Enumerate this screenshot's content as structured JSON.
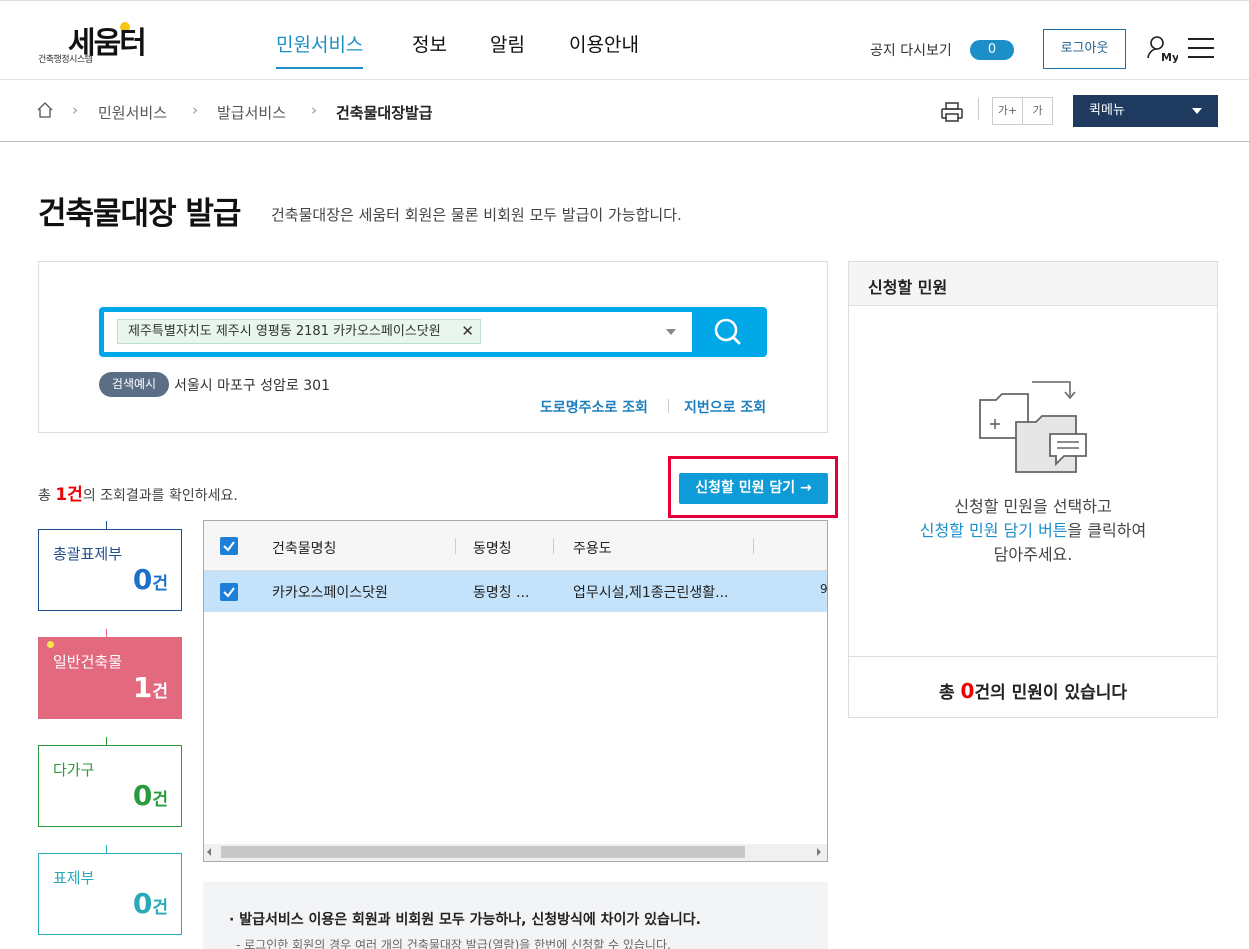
{
  "header": {
    "logo_main": "세움터",
    "logo_sub": "건축행정시스템",
    "nav": [
      "민원서비스",
      "정보",
      "알림",
      "이용안내"
    ],
    "notice_label": "공지 다시보기",
    "notice_count": "0",
    "logout_label": "로그아웃"
  },
  "breadcrumb": {
    "items": [
      "민원서비스",
      "발급서비스",
      "건축물대장발급"
    ],
    "font_up": "가+",
    "font_down": "가",
    "quickmenu": "퀵메뉴"
  },
  "page": {
    "title": "건축물대장 발급",
    "description": "건축물대장은 세움터 회원은 물론 비회원 모두 발급이 가능합니다."
  },
  "search": {
    "chip": "제주특별자치도 제주시 영평동 2181 카카오스페이스닷원",
    "example_badge": "검색예시",
    "example_text": "서울시 마포구 성암로 301",
    "road_link": "도로명주소로 조회",
    "lot_link": "지번으로 조회"
  },
  "result": {
    "prefix": "총 ",
    "count": "1건",
    "suffix": "의 조회결과를 확인하세요.",
    "add_button": "신청할 민원 담기 →"
  },
  "categories": [
    {
      "label": "총괄표제부",
      "count": "0",
      "unit": "건"
    },
    {
      "label": "일반건축물",
      "count": "1",
      "unit": "건"
    },
    {
      "label": "다가구",
      "count": "0",
      "unit": "건"
    },
    {
      "label": "표제부",
      "count": "0",
      "unit": "건"
    }
  ],
  "table": {
    "columns": [
      "건축물명칭",
      "동명칭",
      "주용도"
    ],
    "rows": [
      {
        "name": "카카오스페이스닷원",
        "dong": "동명칭 ...",
        "use": "업무시설,제1종근린생활...",
        "extra": "9"
      }
    ]
  },
  "notice": {
    "line1": "· 발급서비스 이용은 회원과 비회원 모두 가능하나, 신청방식에 차이가 있습니다.",
    "line2": "- 로그인한 회원의 경우 여러 개의 건축물대장 발급(열람)을 한번에 신청할 수 있습니다."
  },
  "cart": {
    "title": "신청할 민원",
    "guide1": "신청할 민원을 선택하고",
    "guide2_blue": "신청할 민원 담기 버튼",
    "guide2_rest": "을 클릭하여",
    "guide3": "담아주세요.",
    "total_prefix": "총 ",
    "total_count": "0",
    "total_suffix": "건의 민원이 있습니다"
  },
  "colors": {
    "accent": "#1d8fc8",
    "highlight": "#e6003a",
    "general_card": "#e2697e",
    "selected_row": "#c4e3fb"
  }
}
